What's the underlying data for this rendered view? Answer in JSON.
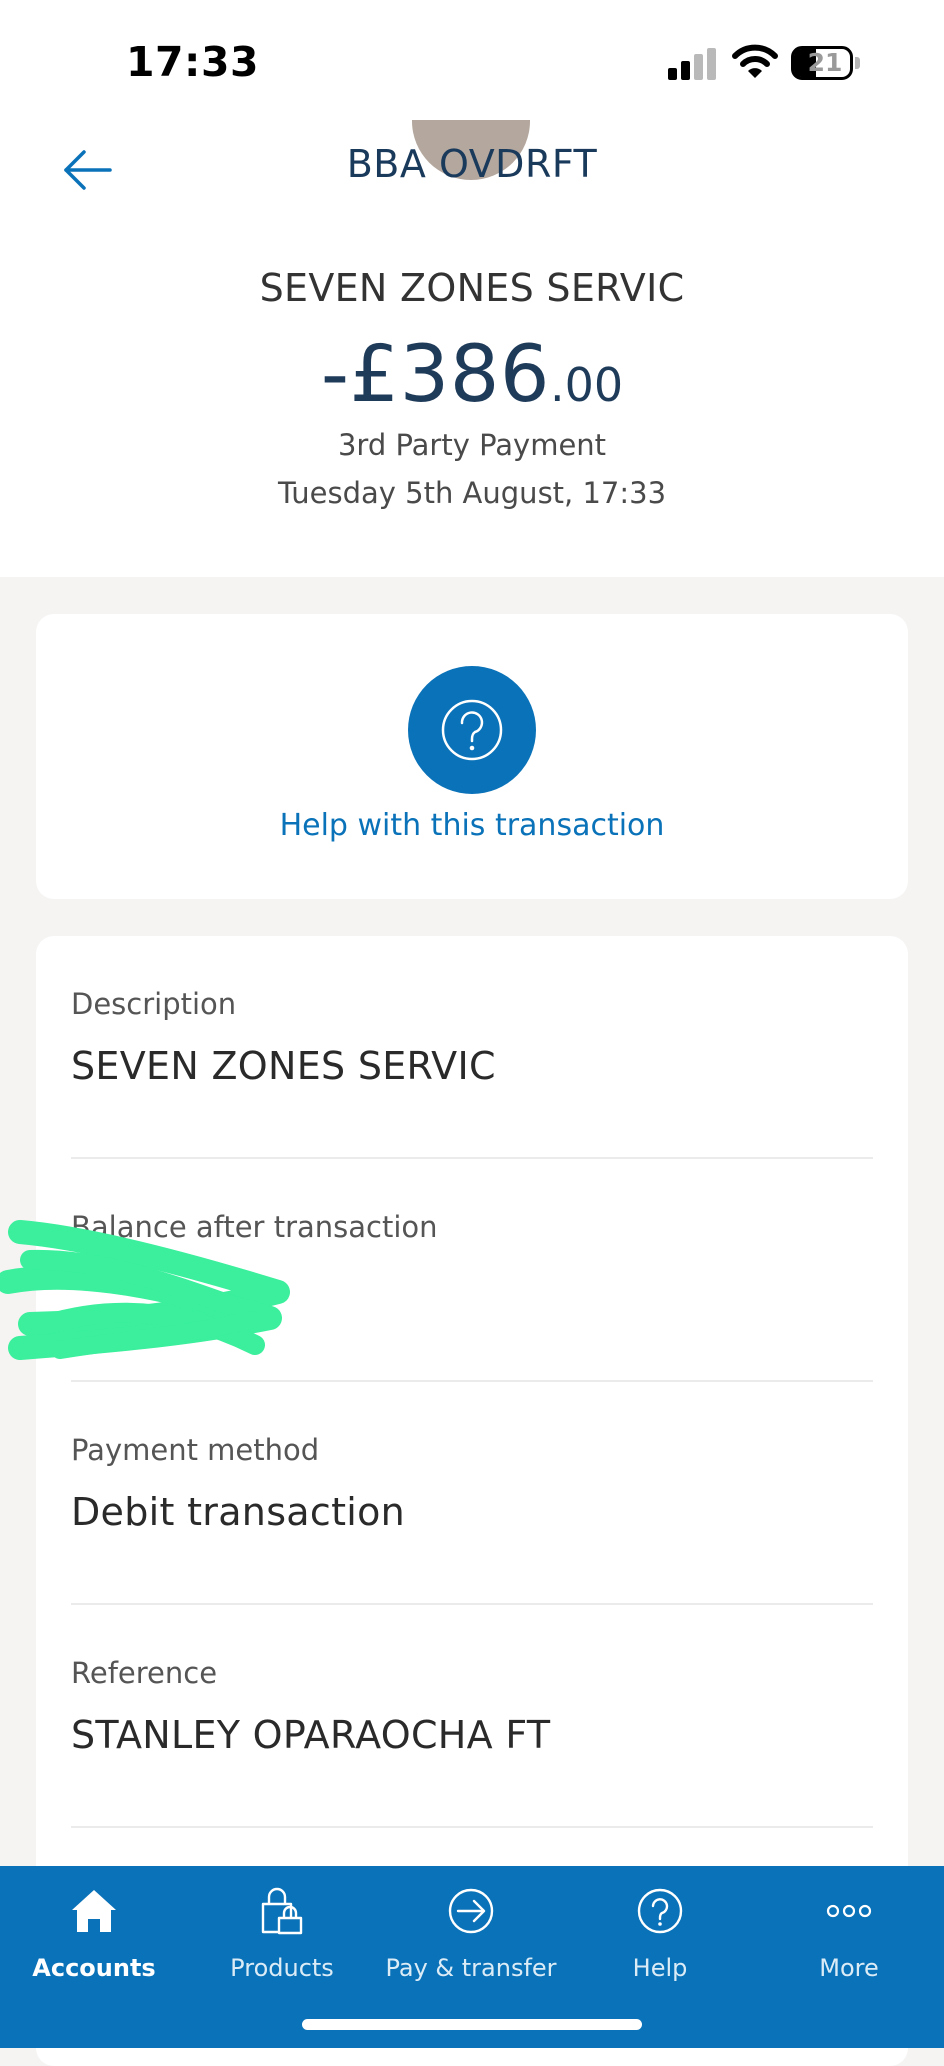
{
  "status_bar": {
    "time": "17:33",
    "battery_level": "21"
  },
  "header": {
    "title": "BBA OVDRFT",
    "back_icon": "arrow-left-icon"
  },
  "transaction": {
    "merchant": "SEVEN ZONES SERVIC",
    "amount_main": "-£386",
    "amount_pence": ".00",
    "type": "3rd Party Payment",
    "date": "Tuesday 5th August, 17:33"
  },
  "help": {
    "icon": "question-circle-icon",
    "label": "Help with this transaction"
  },
  "details": [
    {
      "label": "Description",
      "value": "SEVEN ZONES SERVIC"
    },
    {
      "label": "Balance after transaction",
      "value": ""
    },
    {
      "label": "Payment method",
      "value": "Debit transaction"
    },
    {
      "label": "Reference",
      "value": "STANLEY OPARAOCHA FT"
    }
  ],
  "tab_bar": {
    "items": [
      {
        "label": "Accounts",
        "icon": "home-icon",
        "active": true
      },
      {
        "label": "Products",
        "icon": "shopping-bag-icon",
        "active": false
      },
      {
        "label": "Pay & transfer",
        "icon": "transfer-arrow-icon",
        "active": false
      },
      {
        "label": "Help",
        "icon": "question-icon",
        "active": false
      },
      {
        "label": "More",
        "icon": "more-dots-icon",
        "active": false
      }
    ]
  },
  "colors": {
    "brand_blue": "#0a72b8",
    "title_navy": "#1a3a5c",
    "redaction_green": "#3bef9c"
  }
}
